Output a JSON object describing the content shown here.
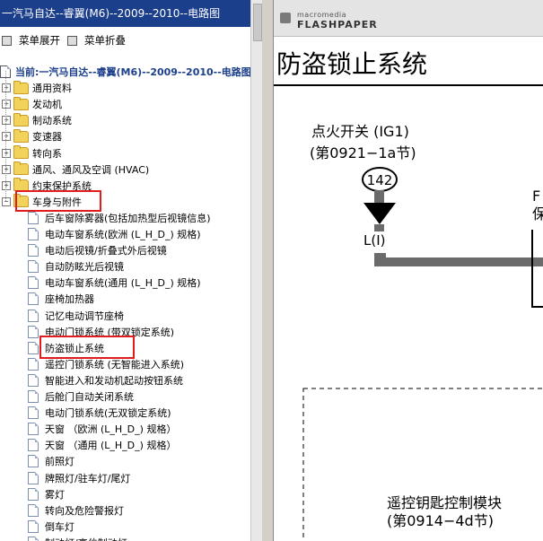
{
  "left_panel": {
    "title": "一汽马自达--睿翼(M6)--2009--2010--电路图",
    "toolbar": {
      "expand_label": "菜单展开",
      "collapse_label": "菜单折叠"
    },
    "tree": {
      "root": "当前:一汽马自达--睿翼(M6)--2009--2010--电路图",
      "folders": [
        "通用资料",
        "发动机",
        "制动系统",
        "变速器",
        "转向系",
        "通风、通风及空调 (HVAC)",
        "约束保护系统"
      ],
      "open_folder": "车身与附件",
      "docs": [
        "后车窗除雾器(包括加热型后视镜信息)",
        "电动车窗系统(欧洲 (L_H_D_) 规格)",
        "电动后视镜/折叠式外后视镜",
        "自动防眩光后视镜",
        "电动车窗系统(通用 (L_H_D_) 规格)",
        "座椅加热器",
        "记忆电动调节座椅",
        "电动门锁系统 (带双锁定系统)",
        "防盗锁止系统",
        "遥控门锁系统 (无智能进入系统)",
        "智能进入和发动机起动按钮系统",
        "后舱门自动关闭系统",
        "电动门锁系统(无双锁定系统)",
        "天窗  （欧洲 (L_H_D_) 规格）",
        "天窗  （通用 (L_H_D_) 规格）",
        "前照灯",
        "牌照灯/驻车灯/尾灯",
        "雾灯",
        "转向及危险警报灯",
        "倒车灯",
        "制动灯/高位制动灯"
      ],
      "selected_index": 8
    }
  },
  "right_panel": {
    "brand_top": "macromedia",
    "brand_bottom": "FLASHPAPER",
    "doc_title": "防盗锁止系统",
    "diagram": {
      "switch_label": "点火开关 (IG1)",
      "switch_ref": "(第0921−1a节)",
      "connector_no": "142",
      "pin_label": "L(I)",
      "side_text_1": "F",
      "side_text_2": "保",
      "module_label": "遥控钥匙控制模块",
      "module_ref": "(第0914−4d节)"
    }
  },
  "colors": {
    "title_bar": "#1c3f8c",
    "highlight": "#e21c1c",
    "wire": "#6b6b6b"
  }
}
